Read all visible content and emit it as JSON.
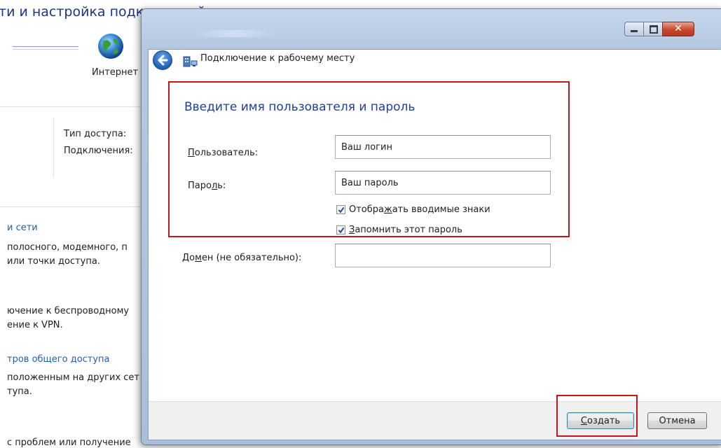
{
  "background": {
    "title": "ти и настройка подключений",
    "internet_label": "Интернет",
    "access_type_label": "Тип доступа:",
    "connections_label": "Подключения:",
    "section_link_networks": "и сети",
    "desc1_line1": "полосного, модемного, п",
    "desc1_line2": "или точки доступа.",
    "desc2_line1": "ючение к беспроводному",
    "desc2_line2": "ение к VPN.",
    "section_link_sharing": "тров общего доступа",
    "desc3_line1": "положенным на других сет",
    "desc3_line2": "тупа.",
    "bottom_text": "с проблем или получение"
  },
  "dialog": {
    "title": "Подключение к рабочему месту",
    "heading": "Введите имя пользователя и пароль",
    "user": {
      "label_accel": "П",
      "label_rest": "ользователь:",
      "value": "Ваш логин"
    },
    "password": {
      "label_pre": "Паро",
      "label_accel": "л",
      "label_rest": "ь:",
      "value": "Ваш пароль"
    },
    "show_chars": {
      "pre": "Отобра",
      "accel": "ж",
      "post": "ать вводимые знаки",
      "checked": true
    },
    "remember": {
      "pre": "",
      "accel": "З",
      "post": "апомнить этот пароль",
      "checked": true
    },
    "domain": {
      "label_pre": "До",
      "label_accel": "м",
      "label_rest": "ен (не обязательно):",
      "value": ""
    },
    "create_button": {
      "accel": "С",
      "rest": "оздать"
    },
    "cancel_button": "Отмена"
  },
  "colors": {
    "highlight": "#c4161c",
    "heading": "#1e3f9a",
    "link": "#1f5fb7"
  }
}
